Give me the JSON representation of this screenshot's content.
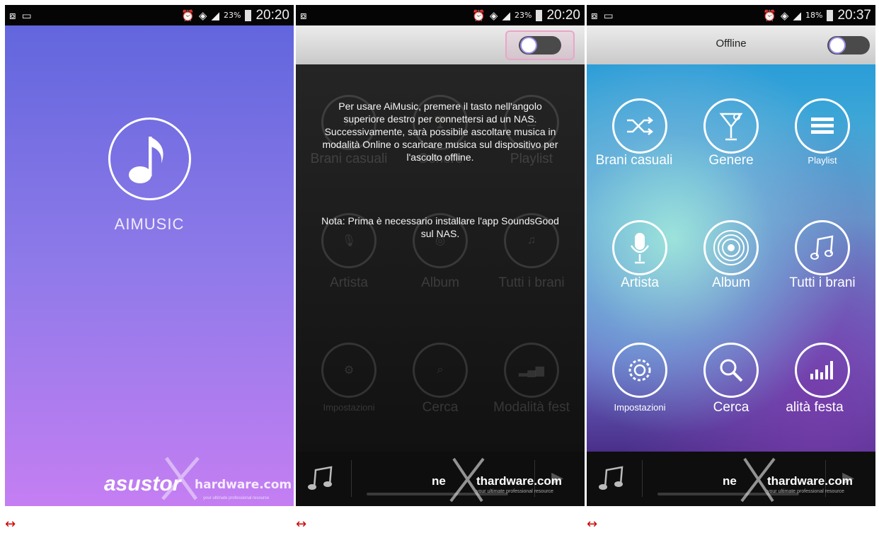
{
  "status_bars": [
    {
      "battery": "23%",
      "time": "20:20"
    },
    {
      "battery": "23%",
      "time": "20:20"
    },
    {
      "battery": "18%",
      "time": "20:37"
    }
  ],
  "splash": {
    "app_name": "AIMUSIC",
    "brand": "asustor"
  },
  "watermark": {
    "text": "nethardware.com",
    "brand_prefix": "ne",
    "brand_suffix": "thardware.com",
    "sub": "your ultimate professional resource",
    "short": "hardware.com"
  },
  "dialog": {
    "message": "Per usare AiMusic, premere il tasto nell'angolo superiore destro per connettersi ad un NAS. Successivamente, sarà possibile ascoltare musica in modalità Online o scaricare musica sul dispositivo per l'ascolto offline.",
    "note": "Nota: Prima è necessario installare l'app SoundsGood sul NAS."
  },
  "header": {
    "mode": "Offline"
  },
  "menu_dim": [
    "Brani casuali",
    "Genere",
    "Playlist",
    "Artista",
    "Album",
    "Tutti i brani",
    "Impostazioni",
    "Cerca",
    "Modalità fest"
  ],
  "menu": [
    "Brani casuali",
    "Genere",
    "Playlist",
    "Artista",
    "Album",
    "Tutti i brani",
    "Impostazioni",
    "Cerca",
    "alità festa"
  ],
  "icons": [
    "shuffle-icon",
    "cocktail-icon",
    "list-icon",
    "microphone-icon",
    "vinyl-icon",
    "music-note-icon",
    "gear-icon",
    "search-icon",
    "equalizer-icon"
  ],
  "colors": {
    "splash_top": "#6266dd",
    "splash_bottom": "#c47ef2",
    "toggle_knob_border": "#9a8fe8"
  }
}
